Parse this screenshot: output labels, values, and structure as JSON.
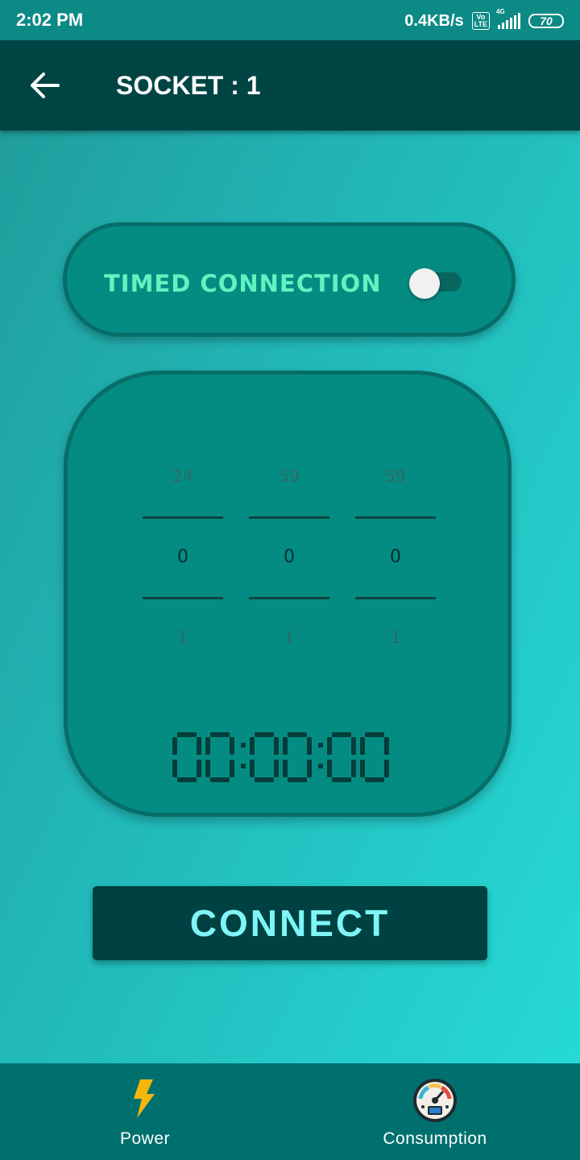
{
  "status_bar": {
    "time": "2:02 PM",
    "speed": "0.4KB/s",
    "volte_top": "Vo",
    "volte_bottom": "LTE",
    "network": "4G",
    "battery": "70"
  },
  "header": {
    "title": "SOCKET : 1",
    "back_icon": "arrow-left-icon"
  },
  "timed_connection": {
    "label": "TIMED CONNECTION",
    "enabled": false
  },
  "timer": {
    "hours": {
      "prev": "24",
      "current": "0",
      "next": "1"
    },
    "minutes": {
      "prev": "59",
      "current": "0",
      "next": "1"
    },
    "seconds": {
      "prev": "59",
      "current": "0",
      "next": "1"
    },
    "display": "00:00:00"
  },
  "connect_button": {
    "label": "CONNECT"
  },
  "bottom_nav": {
    "items": [
      {
        "label": "Power",
        "icon": "lightning-bolt-icon"
      },
      {
        "label": "Consumption",
        "icon": "speedometer-icon"
      }
    ]
  },
  "colors": {
    "accent_text": "#5ff3bf",
    "button_text": "#7ff5f7",
    "app_bar": "#004444",
    "card": "#058c82",
    "bolt": "#f5b70c"
  }
}
